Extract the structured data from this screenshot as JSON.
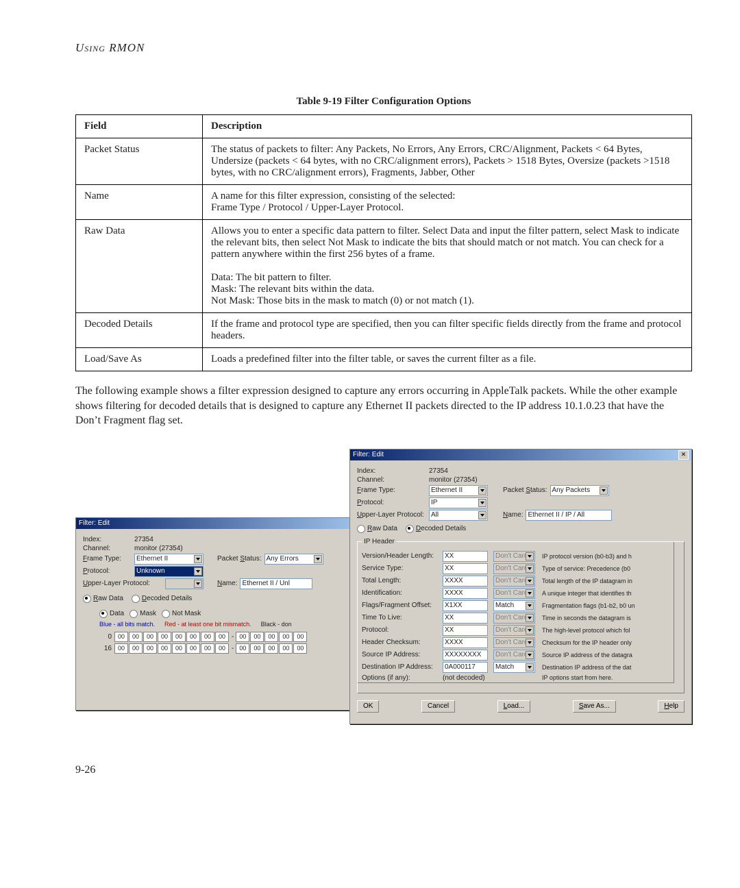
{
  "running_head": "Using RMON",
  "table_caption": "Table 9-19  Filter Configuration Options",
  "columns": {
    "field": "Field",
    "desc": "Description"
  },
  "rows": [
    {
      "field": "Packet Status",
      "desc": "The status of packets to filter: Any Packets, No Errors, Any Errors, CRC/Alignment, Packets < 64 Bytes, Undersize (packets < 64 bytes, with no CRC/alignment errors), Packets > 1518 Bytes, Oversize (packets >1518 bytes, with no CRC/alignment errors), Fragments, Jabber, Other"
    },
    {
      "field": "Name",
      "desc": "A name for this filter expression, consisting of the selected:\nFrame Type / Protocol / Upper-Layer Protocol."
    },
    {
      "field": "Raw Data",
      "desc": "Allows you to enter a specific data pattern to filter. Select Data and input the filter pattern, select Mask to indicate the relevant bits, then select Not Mask to indicate the bits that should match or not match. You can check for a pattern anywhere within the first 256 bytes of a frame.\n\nData: The bit pattern to filter.\nMask: The relevant bits within the data.\nNot Mask: Those bits in the mask to match (0) or not match (1)."
    },
    {
      "field": "Decoded Details",
      "desc": "If the frame and protocol type are specified, then you can filter specific fields directly from the frame and protocol headers."
    },
    {
      "field": "Load/Save As",
      "desc": "Loads a predefined filter into the filter table, or saves the current filter as a file."
    }
  ],
  "body_para": "The following example shows a filter expression designed to capture any errors occurring in AppleTalk packets. While the other example shows filtering for decoded details that is designed to capture any Ethernet II packets directed to the IP address 10.1.0.23 that have the Don’t Fragment flag set.",
  "page_num": "9-26",
  "dlg1": {
    "title": "Filter: Edit",
    "index_lbl": "Index:",
    "index_val": "27354",
    "channel_lbl": "Channel:",
    "channel_val": "monitor (27354)",
    "frame_lbl": "Frame Type:",
    "frame_val": "Ethernet II",
    "pkt_lbl": "Packet Status:",
    "pkt_val": "Any Errors",
    "proto_lbl": "Protocol:",
    "proto_val": "Unknown",
    "upper_lbl": "Upper-Layer Protocol:",
    "upper_val": "",
    "name_lbl": "Name:",
    "name_val": "Ethernet II / Unl",
    "raw_lbl": "Raw Data",
    "dec_lbl": "Decoded Details",
    "data_lbl": "Data",
    "mask_lbl": "Mask",
    "notmask_lbl": "Not Mask",
    "legend_blue": "Blue - all bits match.",
    "legend_red": "Red - at least one bit mismatch.",
    "legend_black": "Black - don",
    "rows": [
      "0",
      "16"
    ],
    "cell": "00",
    "dash": "-"
  },
  "dlg2": {
    "title": "Filter: Edit",
    "index_lbl": "Index:",
    "index_val": "27354",
    "channel_lbl": "Channel:",
    "channel_val": "monitor (27354)",
    "frame_lbl": "Frame Type:",
    "frame_val": "Ethernet II",
    "pkt_lbl": "Packet Status:",
    "pkt_val": "Any Packets",
    "proto_lbl": "Protocol:",
    "proto_val": "IP",
    "upper_lbl": "Upper-Layer Protocol:",
    "upper_val": "All",
    "name_lbl": "Name:",
    "name_val": "Ethernet II / IP / All",
    "raw_lbl": "Raw Data",
    "dec_lbl": "Decoded Details",
    "group_lbl": "IP Header",
    "dontcare": "Don't Care",
    "match": "Match",
    "items": [
      {
        "lbl": "Version/Header Length:",
        "val": "XX",
        "mode": "dc",
        "desc": "IP protocol version (b0-b3) and h"
      },
      {
        "lbl": "Service Type:",
        "val": "XX",
        "mode": "dc",
        "desc": "Type of service: Precedence (b0"
      },
      {
        "lbl": "Total Length:",
        "val": "XXXX",
        "mode": "dc",
        "desc": "Total length of the IP datagram in"
      },
      {
        "lbl": "Identification:",
        "val": "XXXX",
        "mode": "dc",
        "desc": "A unique integer that identifies th"
      },
      {
        "lbl": "Flags/Fragment Offset:",
        "val": "X1XX",
        "mode": "m",
        "desc": "Fragmentation flags (b1-b2, b0 un"
      },
      {
        "lbl": "Time To Live:",
        "val": "XX",
        "mode": "dc",
        "desc": "Time in seconds the datagram is"
      },
      {
        "lbl": "Protocol:",
        "val": "XX",
        "mode": "dc",
        "desc": "The high-level protocol which fol"
      },
      {
        "lbl": "Header Checksum:",
        "val": "XXXX",
        "mode": "dc",
        "desc": "Checksum for the IP header only"
      },
      {
        "lbl": "Source IP Address:",
        "val": "XXXXXXXX",
        "mode": "dc",
        "desc": "Source IP address of the datagra"
      },
      {
        "lbl": "Destination IP Address:",
        "val": "0A000117",
        "mode": "m",
        "desc": "Destination IP address of the dat"
      },
      {
        "lbl": "Options (if any):",
        "val": "(not decoded)",
        "mode": "none",
        "desc": "IP options start from here."
      }
    ],
    "buttons": {
      "ok": "OK",
      "cancel": "Cancel",
      "load": "Load...",
      "save": "Save As...",
      "help": "Help"
    }
  }
}
